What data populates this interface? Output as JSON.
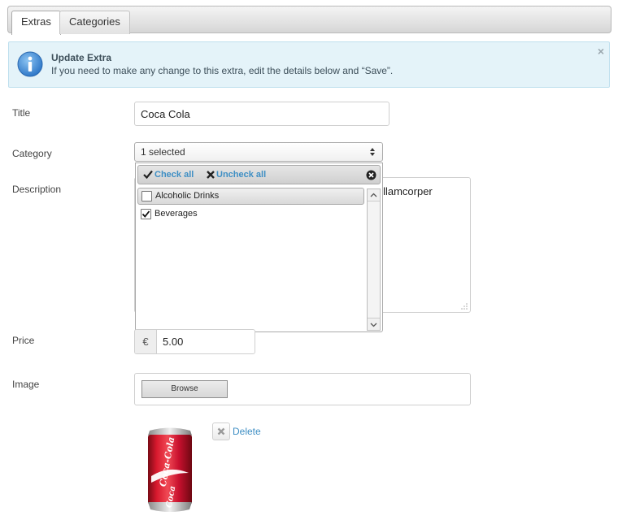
{
  "tabs": [
    {
      "label": "Extras",
      "active": true
    },
    {
      "label": "Categories",
      "active": false
    }
  ],
  "alert": {
    "title": "Update Extra",
    "text": "If you need to make any change to this extra, edit the details below and “Save”.",
    "close": "×",
    "icon": "info-icon",
    "color": "#e4f3f9"
  },
  "form": {
    "title_label": "Title",
    "title_value": "Coca Cola",
    "category_label": "Category",
    "category_value": "1 selected",
    "description_label": "Description",
    "description_visible_text": "n ullamcorper",
    "price_label": "Price",
    "price_currency": "€",
    "price_value": "5.00",
    "image_label": "Image",
    "browse_label": "Browse",
    "delete_label": "Delete"
  },
  "category_dropdown": {
    "check_all": "Check all",
    "uncheck_all": "Uncheck all",
    "options": [
      {
        "label": "Alcoholic Drinks",
        "checked": false
      },
      {
        "label": "Beverages",
        "checked": true
      }
    ]
  },
  "colors": {
    "link": "#3f8fc4",
    "info_icon": "#3f8fd8",
    "can_red": "#c8102e"
  }
}
